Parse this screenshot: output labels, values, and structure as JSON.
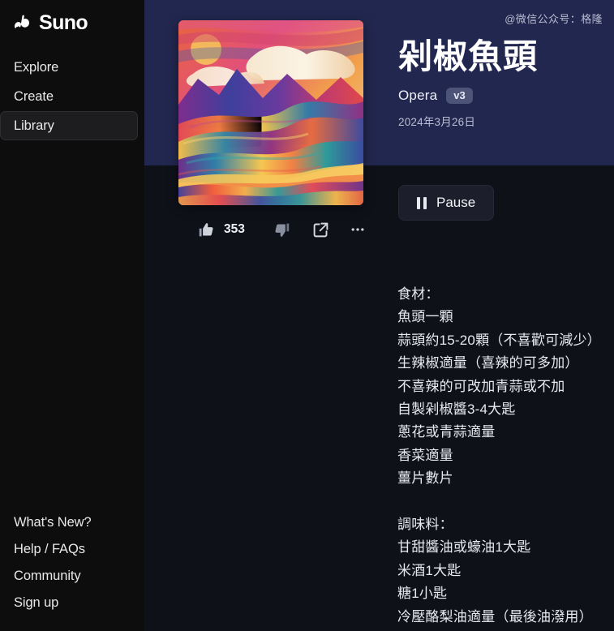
{
  "brand": {
    "name": "Suno",
    "logo_icon": "suno-wave-note-logo"
  },
  "sidebar": {
    "main_items": [
      {
        "label": "Explore",
        "name": "explore",
        "active": false
      },
      {
        "label": "Create",
        "name": "create",
        "active": false
      },
      {
        "label": "Library",
        "name": "library",
        "active": true
      }
    ],
    "bottom_items": [
      {
        "label": "What's New?",
        "name": "whats-new"
      },
      {
        "label": "Help / FAQs",
        "name": "help-faqs"
      },
      {
        "label": "Community",
        "name": "community"
      },
      {
        "label": "Sign up",
        "name": "sign-up"
      }
    ]
  },
  "watermark": {
    "text": "@微信公众号：格隆"
  },
  "song": {
    "title": "剁椒魚頭",
    "genre": "Opera",
    "version": "v3",
    "date": "2024年3月26日",
    "cover_icon": "abstract-colorful-mountain-landscape-artwork"
  },
  "player": {
    "pause_label": "Pause",
    "pause_icon": "pause-icon"
  },
  "actions": {
    "like_icon": "thumbs-up-icon",
    "like_count": "353",
    "dislike_icon": "thumbs-down-icon",
    "share_icon": "share-icon",
    "more_icon": "more-horizontal-icon"
  },
  "lyrics": {
    "text": "食材：\n魚頭一顆\n蒜頭約15-20顆（不喜歡可減少）\n生辣椒適量（喜辣的可多加）\n不喜辣的可改加青蒜或不加\n自製剁椒醬3-4大匙\n蔥花或青蒜適量\n香菜適量\n薑片數片\n\n調味料：\n甘甜醬油或蠔油1大匙\n米酒1大匙\n糖1小匙\n冷壓酪梨油適量（最後油潑用）"
  },
  "colors": {
    "sidebar_bg": "#0d0d0d",
    "main_bg": "#0f1119",
    "hero_band": "#222750",
    "badge_bg": "#4c5478",
    "text_primary": "#ffffff"
  }
}
